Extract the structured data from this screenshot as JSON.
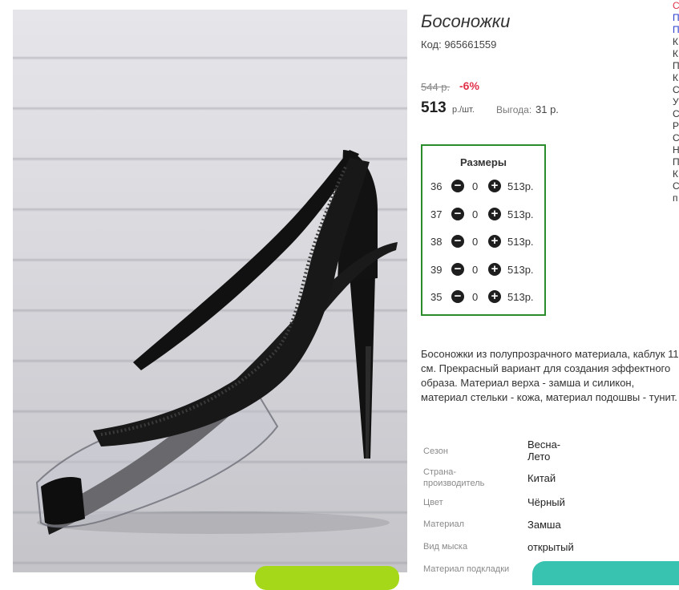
{
  "product": {
    "title": "Босоножки",
    "code": "Код: 965661559",
    "old_price": "544 р.",
    "discount": "-6%",
    "price": "513",
    "price_unit": "р./шт.",
    "benefit_label": "Выгода:",
    "benefit_value": "31 р."
  },
  "sizes": {
    "title": "Размеры",
    "rows": [
      {
        "size": "36",
        "qty": "0",
        "price": "513р."
      },
      {
        "size": "37",
        "qty": "0",
        "price": "513р."
      },
      {
        "size": "38",
        "qty": "0",
        "price": "513р."
      },
      {
        "size": "39",
        "qty": "0",
        "price": "513р."
      },
      {
        "size": "35",
        "qty": "0",
        "price": "513р."
      }
    ]
  },
  "description": "Босоножки из полупрозрачного материала, каблук 11 см. Прекрасный вариант для создания эффектного образа. Материал верха - замша и силикон, материал стельки - кожа, материал подошвы - тунит.",
  "properties": [
    {
      "label": "Сезон",
      "value": "Весна-\nЛето"
    },
    {
      "label": "Страна-\nпроизводитель",
      "value": "Китай"
    },
    {
      "label": "Цвет",
      "value": "Чёрный"
    },
    {
      "label": "Материал",
      "value": "Замша"
    },
    {
      "label": "Вид мыска",
      "value": "открытый"
    },
    {
      "label": "Материал подкладки",
      "value": ""
    }
  ],
  "side_column": [
    "С",
    "П",
    "П",
    "К",
    "К",
    "П",
    "К",
    "С",
    "У",
    "С",
    "Р",
    "С",
    "Н",
    "П",
    "К",
    "С",
    "п"
  ],
  "icons": {
    "minus": "minus-circle-icon",
    "plus": "plus-circle-icon"
  },
  "colors": {
    "accent_border": "#2a8c2a",
    "discount": "#e0304a",
    "side_link": "#2a3fd0"
  }
}
